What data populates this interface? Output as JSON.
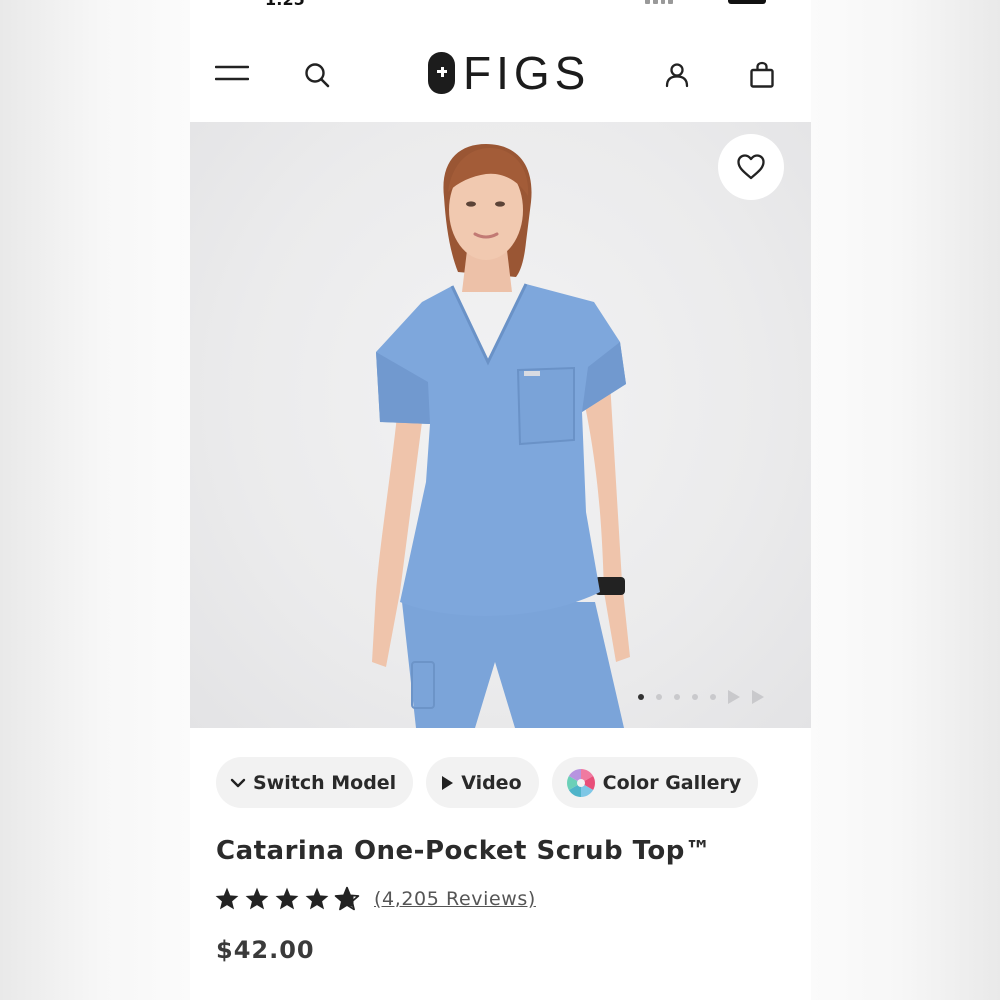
{
  "status_bar": {
    "time": "1:25"
  },
  "header": {
    "brand_name": "FIGS",
    "icons": [
      "menu-icon",
      "search-icon",
      "account-icon",
      "shopping-bag-icon"
    ]
  },
  "gallery": {
    "favorite_icon": "heart-icon",
    "slide_count": 5,
    "active_slide": 1,
    "video_slides": 2
  },
  "chips": {
    "switch_model": "Switch Model",
    "video": "Video",
    "color_gallery": "Color Gallery"
  },
  "product": {
    "title": "Catarina One-Pocket Scrub Top™",
    "rating": 4.5,
    "reviews_label": "(4,205 Reviews)",
    "price": "$42.00"
  },
  "colors": {
    "scrub_blue": "#7ea7dc",
    "text_dark": "#2b2b2b",
    "chip_bg": "#f2f2f2"
  }
}
